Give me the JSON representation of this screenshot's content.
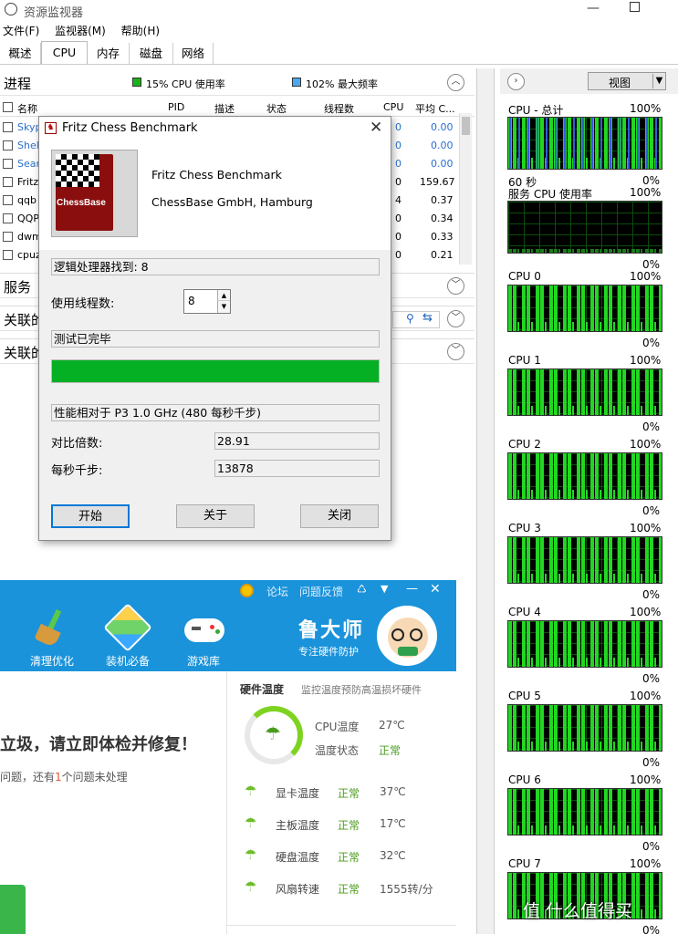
{
  "window": {
    "title": "资源监视器"
  },
  "menu": [
    "文件(F)",
    "监视器(M)",
    "帮助(H)"
  ],
  "tabs": [
    "概述",
    "CPU",
    "内存",
    "磁盘",
    "网络"
  ],
  "processes": {
    "header": "进程",
    "cpu_usage": "15% CPU 使用率",
    "max_freq": "102% 最大频率",
    "columns": [
      "名称",
      "PID",
      "描述",
      "状态",
      "线程数",
      "CPU",
      "平均 C..."
    ],
    "rows": [
      {
        "name": "Skyp",
        "cpu": "0",
        "avg": "0.00"
      },
      {
        "name": "Shel",
        "cpu": "0",
        "avg": "0.00"
      },
      {
        "name": "Sear",
        "cpu": "0",
        "avg": "0.00"
      },
      {
        "name": "Fritz",
        "cpu": "0",
        "avg": "159.67"
      },
      {
        "name": "qqb",
        "cpu": "4",
        "avg": "0.37"
      },
      {
        "name": "QQP",
        "cpu": "0",
        "avg": "0.34"
      },
      {
        "name": "dwm",
        "cpu": "0",
        "avg": "0.33"
      },
      {
        "name": "cpuz",
        "cpu": "0",
        "avg": "0.21"
      }
    ]
  },
  "sections": {
    "services": "服务",
    "assoc1": "关联的",
    "assoc2": "关联的"
  },
  "right": {
    "view": "视图",
    "graphs": [
      {
        "label": "CPU - 总计",
        "max": "100%",
        "bottom_left": "60 秒",
        "bottom_right": "0%"
      },
      {
        "label": "服务 CPU 使用率",
        "max": "100%",
        "bottom_right": "0%"
      },
      {
        "label": "CPU 0",
        "max": "100%",
        "bottom_right": "0%"
      },
      {
        "label": "CPU 1",
        "max": "100%",
        "bottom_right": "0%"
      },
      {
        "label": "CPU 2",
        "max": "100%",
        "bottom_right": "0%"
      },
      {
        "label": "CPU 3",
        "max": "100%",
        "bottom_right": "0%"
      },
      {
        "label": "CPU 4",
        "max": "100%",
        "bottom_right": "0%"
      },
      {
        "label": "CPU 5",
        "max": "100%",
        "bottom_right": "0%"
      },
      {
        "label": "CPU 6",
        "max": "100%",
        "bottom_right": "0%"
      },
      {
        "label": "CPU 7",
        "max": "100%",
        "bottom_right": "0%"
      }
    ]
  },
  "dialog": {
    "title": "Fritz Chess Benchmark",
    "app_name": "Fritz Chess Benchmark",
    "company": "ChessBase GmbH, Hamburg",
    "logo_text": "ChessBase",
    "logical_processors": "逻辑处理器找到: 8",
    "threads_label": "使用线程数:",
    "threads_value": "8",
    "status": "测试已完毕",
    "progress": 1.0,
    "perf_label": "性能相对于 P3 1.0 GHz (480 每秒千步)",
    "ratio_label": "对比倍数:",
    "ratio_value": "28.91",
    "kns_label": "每秒千步:",
    "kns_value": "13878",
    "buttons": {
      "start": "开始",
      "about": "关于",
      "close": "关闭"
    }
  },
  "ludashi": {
    "top_links": [
      "论坛",
      "问题反馈"
    ],
    "nav": [
      "清理优化",
      "装机必备",
      "游戏库"
    ],
    "brand": "鲁大师",
    "slogan": "专注硬件防护",
    "alert": "立圾，请立即体检并修复！",
    "alert_sub_prefix": "问题，还有",
    "alert_sub_count": "1",
    "alert_sub_suffix": "个问题未处理",
    "temp_title": "硬件温度",
    "temp_sub": "监控温度预防高温损坏硬件",
    "cpu_temp_label": "CPU温度",
    "cpu_temp": "27℃",
    "temp_state_label": "温度状态",
    "temp_state": "正常",
    "items": [
      {
        "label": "显卡温度",
        "state": "正常",
        "value": "37℃"
      },
      {
        "label": "主板温度",
        "state": "正常",
        "value": "17℃"
      },
      {
        "label": "硬盘温度",
        "state": "正常",
        "value": "32℃"
      },
      {
        "label": "风扇转速",
        "state": "正常",
        "value": "1555转/分"
      }
    ]
  },
  "watermark": "值 什么值得买"
}
